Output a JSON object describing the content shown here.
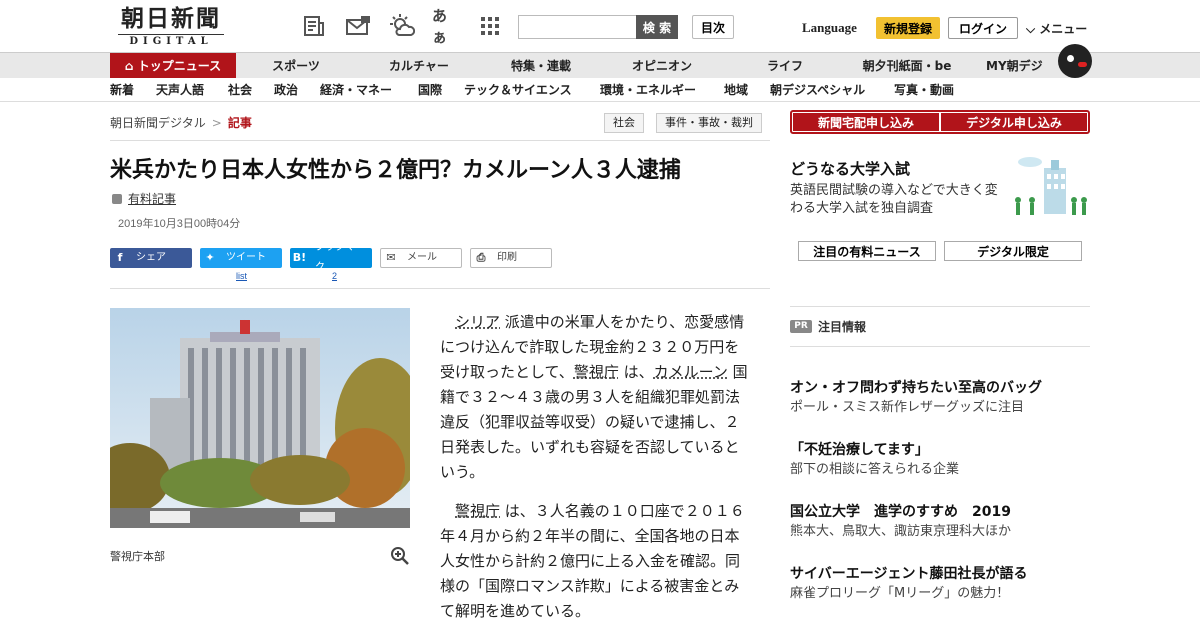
{
  "header": {
    "logo_jp": "朝日新聞",
    "logo_en": "DIGITAL",
    "search_placeholder": "",
    "search_button": "検 索",
    "toc_button": "目次",
    "language": "Language",
    "register": "新規登録",
    "login": "ログイン",
    "menu": "メニュー",
    "icons": [
      "paper-icon",
      "mail-icon",
      "weather-icon",
      "font-size-icon",
      "grid-icon"
    ],
    "font_size_glyph": "あぁ"
  },
  "nav_primary": [
    "トップニュース",
    "スポーツ",
    "カルチャー",
    "特集・連載",
    "オピニオン",
    "ライフ",
    "朝夕刊紙面・be",
    "MY朝デジ"
  ],
  "nav_secondary": [
    "新着",
    "天声人語",
    "社会",
    "政治",
    "経済・マネー",
    "国際",
    "テック＆サイエンス",
    "環境・エネルギー",
    "地域",
    "朝デジスペシャル",
    "写真・動画"
  ],
  "breadcrumb": {
    "home": "朝日新聞デジタル",
    "sep": ">",
    "current": "記事"
  },
  "tags": [
    "社会",
    "事件・事故・裁判"
  ],
  "article": {
    "title": "米兵かたり日本人女性から２億円？カメルーン人３人逮捕",
    "paid_label": "有料記事",
    "date": "2019年10月3日00時04分",
    "share": {
      "facebook": "シェア",
      "twitter": "ツイート",
      "hatena": "ブックマーク",
      "mail": "メール",
      "print": "印刷",
      "twitter_count": "list",
      "hatena_count": "2"
    },
    "caption": "警視庁本部",
    "p1": {
      "a": "シリア",
      "b": " 派遣中の米軍人をかたり、恋愛感情につけ込んで詐取した現金約２３２０万円を受け取ったとして、",
      "c": "警視庁",
      "d": " は、",
      "e": "カメルーン",
      "f": " 国籍で３２～４３歳の男３人を組織犯罪処罰法違反（犯罪収益等収受）の疑いで逮捕し、２日発表した。いずれも容疑を否認しているという。"
    },
    "p2": {
      "a": "警視庁",
      "b": " は、３人名義の１０口座で２０１６年４月から約２年半の間に、全国各地の日本人女性から計約２億円に上る入金を確認。同様の「国際ロマンス詐欺」による被害金とみて解明を進めている。"
    }
  },
  "sidebar": {
    "subscribe_paper": "新聞宅配申し込み",
    "subscribe_digital": "デジタル申し込み",
    "feature_title": "どうなる大学入試",
    "feature_desc": "英語民間試験の導入などで大きく変わる大学入試を独自調査",
    "btn_paid_news": "注目の有料ニュース",
    "btn_digital_only": "デジタル限定",
    "pr_badge": "PR",
    "pr_heading": "注目情報",
    "ads": [
      {
        "h": "オン・オフ問わず持ちたい至高のバッグ",
        "s": "ポール・スミス新作レザーグッズに注目"
      },
      {
        "h": "「不妊治療してます」",
        "s": "部下の相談に答えられる企業"
      },
      {
        "h": "国公立大学　進学のすすめ　2019",
        "s": "熊本大、鳥取大、諏訪東京理科大ほか"
      },
      {
        "h": "サイバーエージェント藤田社長が語る",
        "s": "麻雀プロリーグ「Mリーグ」の魅力！"
      }
    ]
  },
  "colors": {
    "accent": "#b1141a",
    "register": "#f2c131",
    "facebook": "#3b5998",
    "twitter": "#1da1f2",
    "hatena": "#008fde"
  }
}
